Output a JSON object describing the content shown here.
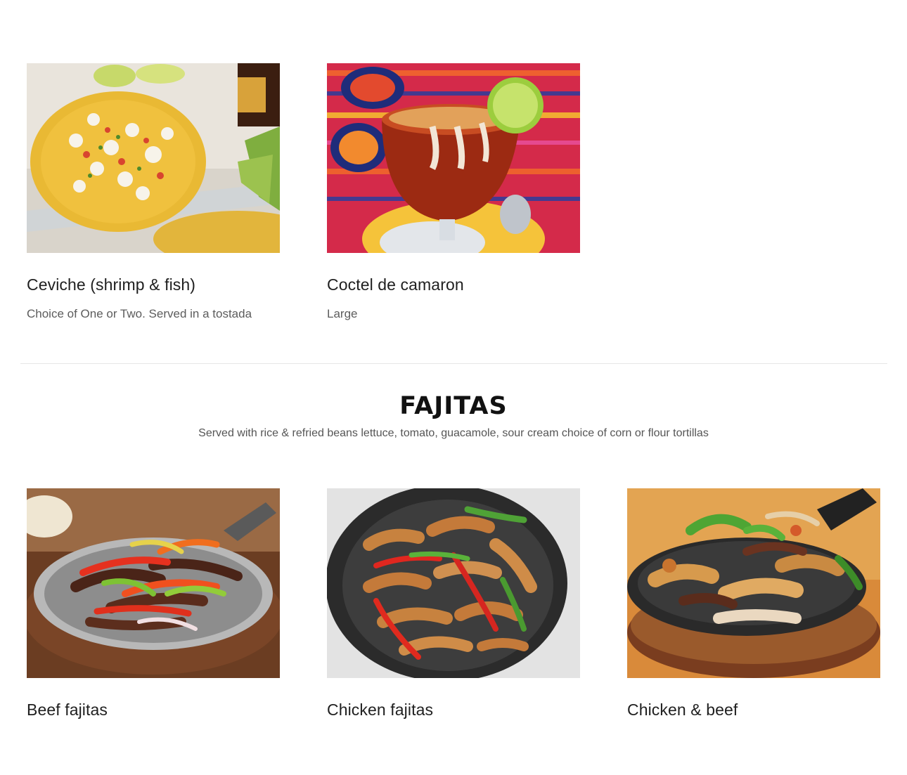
{
  "seafood": {
    "items": [
      {
        "name": "Ceviche (shrimp & fish)",
        "description": "Choice of One or Two. Served in a tostada",
        "image_icon": "ceviche-tostada-photo"
      },
      {
        "name": "Coctel de camaron",
        "description": "Large",
        "image_icon": "shrimp-cocktail-photo"
      }
    ]
  },
  "fajitas": {
    "title": "FAJITAS",
    "subtitle": "Served with rice & refried beans lettuce, tomato, guacamole, sour cream choice of corn or flour tortillas",
    "items": [
      {
        "name": "Beef fajitas",
        "image_icon": "beef-fajitas-photo"
      },
      {
        "name": "Chicken fajitas",
        "image_icon": "chicken-fajitas-photo"
      },
      {
        "name": "Chicken & beef",
        "image_icon": "chicken-beef-fajitas-photo"
      }
    ]
  },
  "colors": {
    "background": "#ffffff",
    "title_text": "#1f1f1f",
    "description_text": "#5c5c5c",
    "divider": "#e6e6e6"
  }
}
